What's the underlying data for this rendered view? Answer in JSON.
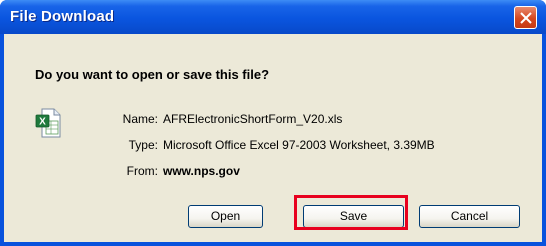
{
  "window": {
    "title": "File Download"
  },
  "dialog": {
    "question": "Do you want to open or save this file?",
    "file": {
      "name_label": "Name:",
      "name_value": "AFRElectronicShortForm_V20.xls",
      "type_label": "Type:",
      "type_value": "Microsoft Office Excel 97-2003 Worksheet, 3.39MB",
      "from_label": "From:",
      "from_value": "www.nps.gov",
      "icon": "excel-file-icon"
    },
    "buttons": {
      "open": "Open",
      "save": "Save",
      "cancel": "Cancel"
    }
  },
  "colors": {
    "titlebar": "#0a55df",
    "body": "#ece9d8",
    "highlight": "#e8001e"
  }
}
